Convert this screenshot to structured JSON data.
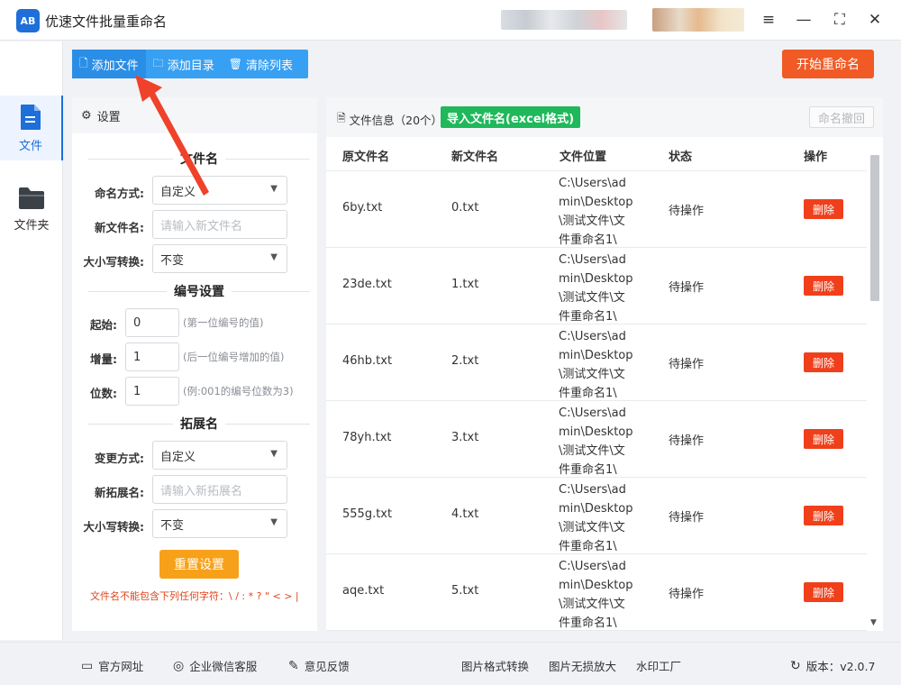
{
  "app": {
    "title": "优速文件批量重命名",
    "logo_text": "AB"
  },
  "window_controls": {
    "menu": "≡",
    "minimize": "—",
    "maximize": "⛶",
    "close": "✕"
  },
  "sidebar": {
    "items": [
      {
        "label": "文件",
        "icon": "file-icon"
      },
      {
        "label": "文件夹",
        "icon": "folder-icon"
      }
    ]
  },
  "toolbar": {
    "add_file": "添加文件",
    "add_dir": "添加目录",
    "clear_list": "清除列表",
    "start": "开始重命名"
  },
  "settings": {
    "header": "设置",
    "filename_section": "文件名",
    "naming_mode_label": "命名方式:",
    "naming_mode_value": "自定义",
    "new_name_label": "新文件名:",
    "new_name_placeholder": "请输入新文件名",
    "case_label": "大小写转换:",
    "case_value": "不变",
    "numbering_section": "编号设置",
    "start_label": "起始:",
    "start_value": "0",
    "start_hint": "(第一位编号的值)",
    "step_label": "增量:",
    "step_value": "1",
    "step_hint": "(后一位编号增加的值)",
    "digits_label": "位数:",
    "digits_value": "1",
    "digits_hint": "(例:001的编号位数为3)",
    "ext_section": "拓展名",
    "ext_mode_label": "变更方式:",
    "ext_mode_value": "自定义",
    "new_ext_label": "新拓展名:",
    "new_ext_placeholder": "请输入新拓展名",
    "ext_case_label": "大小写转换:",
    "ext_case_value": "不变",
    "reset": "重置设置",
    "warning": "文件名不能包含下列任何字符：\\ / : * ? \" < > |"
  },
  "files": {
    "info": "文件信息（20个）",
    "import": "导入文件名(excel格式)",
    "undo": "命名撤回",
    "columns": [
      "原文件名",
      "新文件名",
      "文件位置",
      "状态",
      "操作"
    ],
    "rows": [
      {
        "orig": "6by.txt",
        "new": "0.txt",
        "loc": "C:\\Users\\admin\\Desktop\\测试文件\\文件重命名1\\",
        "status": "待操作",
        "action": "删除"
      },
      {
        "orig": "23de.txt",
        "new": "1.txt",
        "loc": "C:\\Users\\admin\\Desktop\\测试文件\\文件重命名1\\",
        "status": "待操作",
        "action": "删除"
      },
      {
        "orig": "46hb.txt",
        "new": "2.txt",
        "loc": "C:\\Users\\admin\\Desktop\\测试文件\\文件重命名1\\",
        "status": "待操作",
        "action": "删除"
      },
      {
        "orig": "78yh.txt",
        "new": "3.txt",
        "loc": "C:\\Users\\admin\\Desktop\\测试文件\\文件重命名1\\",
        "status": "待操作",
        "action": "删除"
      },
      {
        "orig": "555g.txt",
        "new": "4.txt",
        "loc": "C:\\Users\\admin\\Desktop\\测试文件\\文件重命名1\\",
        "status": "待操作",
        "action": "删除"
      },
      {
        "orig": "aqe.txt",
        "new": "5.txt",
        "loc": "C:\\Users\\admin\\Desktop\\测试文件\\文件重命名1\\",
        "status": "待操作",
        "action": "删除"
      }
    ]
  },
  "footer": {
    "website": "官方网址",
    "wechat": "企业微信客服",
    "feedback": "意见反馈",
    "convert": "图片格式转换",
    "enlarge": "图片无损放大",
    "watermark": "水印工厂",
    "version": "版本：v2.0.7"
  },
  "colors": {
    "accent": "#1e6fd9",
    "toolbar": "#38a0f3",
    "start": "#f15a24",
    "import": "#1fb85a",
    "delete": "#f0401b",
    "reset": "#f7a11a",
    "arrow": "#f0412b"
  }
}
